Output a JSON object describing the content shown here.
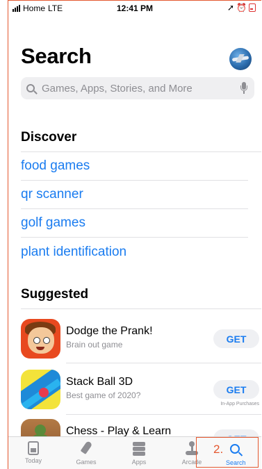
{
  "status_bar": {
    "carrier": "Home",
    "network": "LTE",
    "time": "12:41 PM"
  },
  "header": {
    "title": "Search"
  },
  "search": {
    "placeholder": "Games, Apps, Stories, and More"
  },
  "discover": {
    "title": "Discover",
    "items": [
      {
        "label": "food games"
      },
      {
        "label": "qr scanner"
      },
      {
        "label": "golf games"
      },
      {
        "label": "plant identification"
      }
    ]
  },
  "suggested": {
    "title": "Suggested",
    "apps": [
      {
        "name": "Dodge the Prank!",
        "subtitle": "Brain out game",
        "action": "GET",
        "note": ""
      },
      {
        "name": "Stack Ball 3D",
        "subtitle": "Best game of 2020?",
        "action": "GET",
        "note": "In-App Purchases"
      },
      {
        "name": "Chess - Play & Learn",
        "subtitle": "",
        "action": "GET",
        "note": ""
      }
    ]
  },
  "tab_bar": {
    "tabs": [
      {
        "label": "Today",
        "icon": "today-icon"
      },
      {
        "label": "Games",
        "icon": "rocket-icon"
      },
      {
        "label": "Apps",
        "icon": "layers-icon"
      },
      {
        "label": "Arcade",
        "icon": "joystick-icon"
      },
      {
        "label": "Search",
        "icon": "search-icon"
      }
    ],
    "active": "Search"
  },
  "annotation": {
    "step": "2."
  },
  "colors": {
    "accent": "#1a7cf0",
    "annotation": "#e4572e"
  }
}
